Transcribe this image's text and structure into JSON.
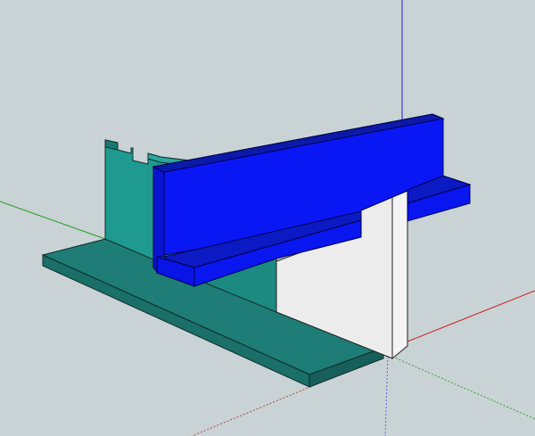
{
  "viewport": {
    "background": "#c9d3d5",
    "axes": {
      "red": "#d22020",
      "green": "#1fa01f",
      "blue": "#2020d0"
    }
  },
  "model": {
    "components": [
      {
        "name": "base-plate",
        "color": "#1f7f78"
      },
      {
        "name": "back-fence",
        "color": "#1f9a90"
      },
      {
        "name": "blue-fence",
        "color": "#0a17ff"
      },
      {
        "name": "white-block",
        "color": "#ececec"
      }
    ]
  }
}
